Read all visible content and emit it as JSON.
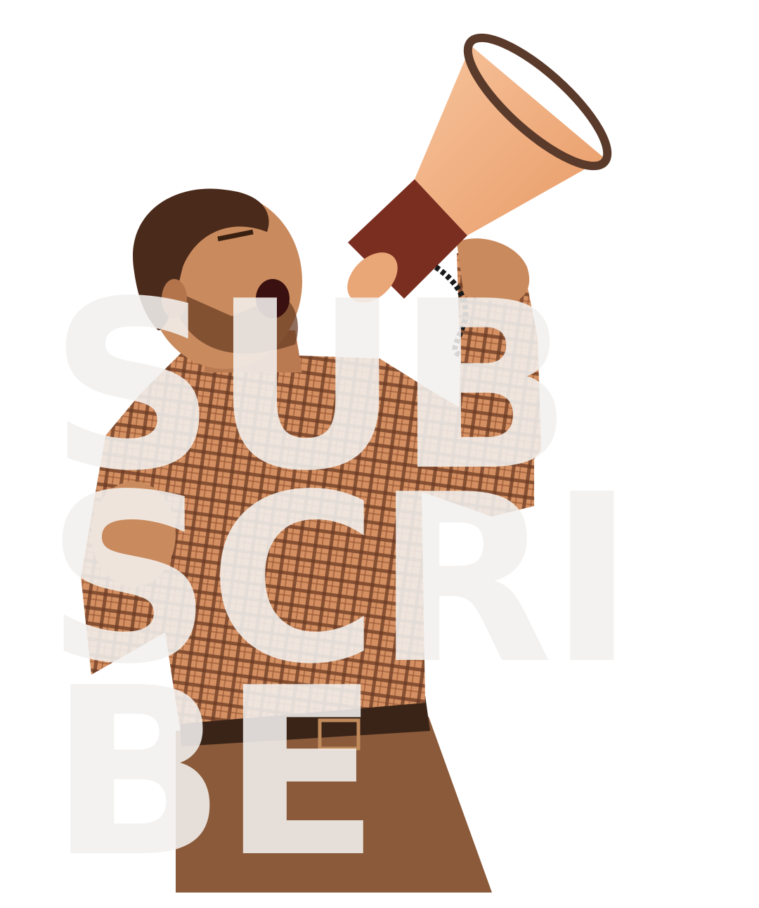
{
  "overlay_text": {
    "row_1": "SUB",
    "row_2": "SCRI",
    "row_3": "BE"
  },
  "colors": {
    "background": "#ffffff",
    "skin": "#c98a5e",
    "hair": "#4a2a1a",
    "shirt_base": "#d49062",
    "shirt_check": "#6b3a22",
    "pants": "#8a5a3a",
    "belt": "#3a2418",
    "megaphone_bell": "#f4b083",
    "megaphone_rim": "#5a3a2a",
    "megaphone_body": "#7a2e20",
    "overlay_text": "#f3f0ee"
  },
  "icons": [
    "megaphone-icon"
  ]
}
